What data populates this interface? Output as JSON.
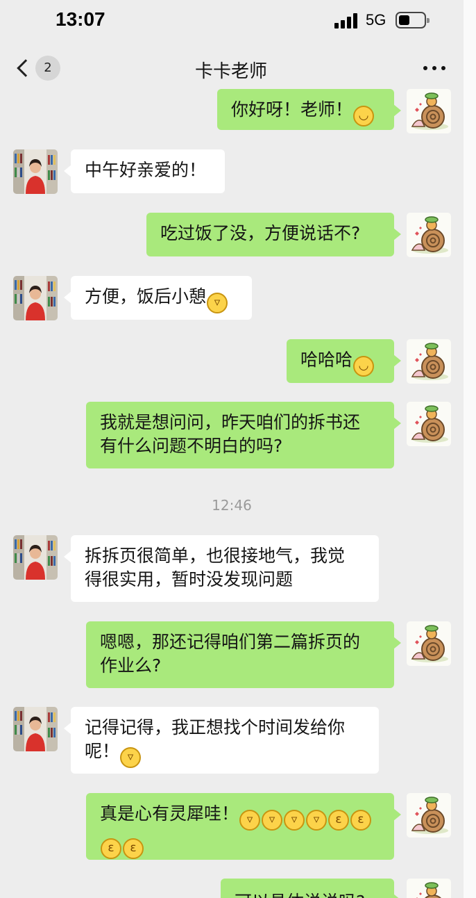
{
  "status": {
    "time": "13:07",
    "network": "5G"
  },
  "nav": {
    "unread_count": "2",
    "title": "卡卡老师"
  },
  "emojis": {
    "smile": "smile-emoji",
    "grin": "grin-emoji",
    "kiss": "kiss-emoji"
  },
  "messages": [
    {
      "side": "out",
      "text": "你好呀！老师！",
      "emoji": [
        "☺"
      ]
    },
    {
      "side": "in",
      "text": "中午好亲爱的！",
      "emoji": []
    },
    {
      "side": "out",
      "text": "吃过饭了没，方便说话不?",
      "emoji": []
    },
    {
      "side": "in",
      "text": "方便，饭后小憩",
      "emoji": [
        "☻"
      ]
    },
    {
      "side": "out",
      "text": "哈哈哈",
      "emoji": [
        "☺"
      ]
    },
    {
      "side": "out",
      "lines": [
        "我就是想问问，昨天咱们的拆书还",
        "有什么问题不明白的吗?"
      ]
    },
    {
      "timestamp": "12:46"
    },
    {
      "side": "in",
      "lines": [
        "拆拆页很简单，也很接地气，我觉",
        "得很实用，暂时没发现问题"
      ]
    },
    {
      "side": "out",
      "lines": [
        "嗯嗯，那还记得咱们第二篇拆页的",
        "作业么?"
      ]
    },
    {
      "side": "in",
      "lines": [
        "记得记得，我正想找个时间发给你",
        "呢！"
      ]
    },
    {
      "side": "out",
      "lines": [
        "真是心有灵犀哇！",
        ""
      ]
    },
    {
      "side": "out",
      "text": "可以具体说说吗?"
    }
  ]
}
